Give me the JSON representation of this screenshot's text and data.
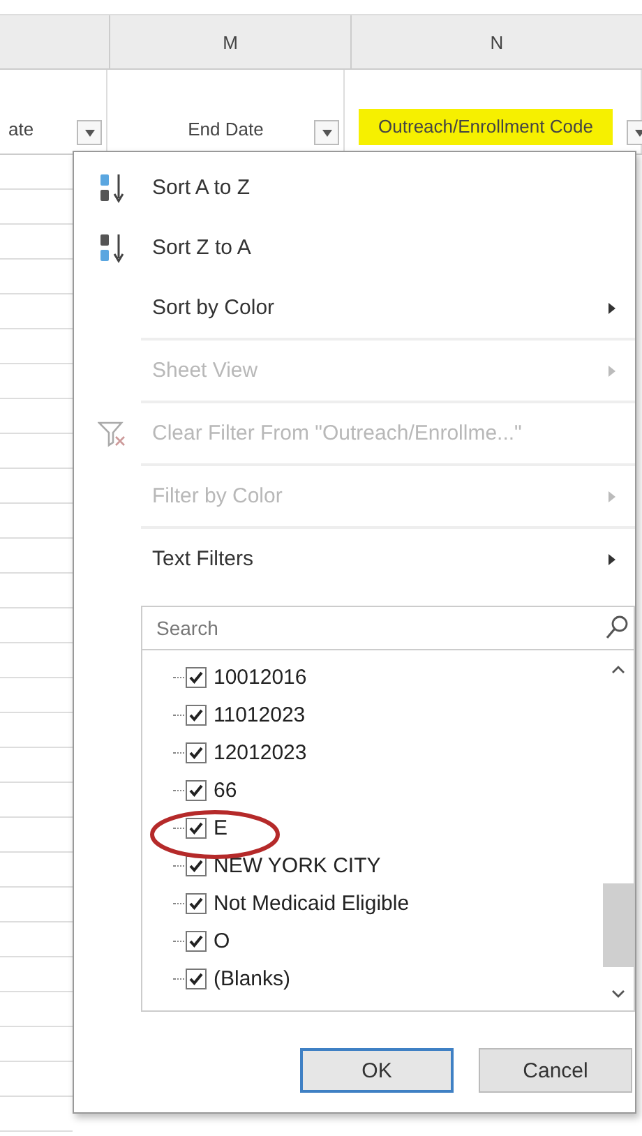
{
  "column_headers": [
    {
      "label": "M"
    },
    {
      "label": "N"
    }
  ],
  "header_cells": [
    {
      "text": "ate",
      "highlighted": false
    },
    {
      "text": "End Date",
      "highlighted": false
    },
    {
      "text": "Outreach/Enrollment Code",
      "highlighted": true
    }
  ],
  "menu": {
    "items": [
      {
        "label": "Sort A to Z",
        "kind": "sort-az",
        "disabled": false,
        "submenu": false
      },
      {
        "label": "Sort Z to A",
        "kind": "sort-za",
        "disabled": false,
        "submenu": false
      },
      {
        "label": "Sort by Color",
        "kind": "plain",
        "disabled": false,
        "submenu": true
      },
      {
        "label": "Sheet View",
        "kind": "plain",
        "disabled": true,
        "submenu": true
      },
      {
        "label": "Clear Filter From \"Outreach/Enrollme...\"",
        "kind": "clear-filter",
        "disabled": true,
        "submenu": false
      },
      {
        "label": "Filter by Color",
        "kind": "plain",
        "disabled": true,
        "submenu": true
      },
      {
        "label": "Text Filters",
        "kind": "plain",
        "disabled": false,
        "submenu": true
      }
    ],
    "search": {
      "placeholder": "Search"
    },
    "values": [
      {
        "label": "10012016",
        "checked": true
      },
      {
        "label": "11012023",
        "checked": true
      },
      {
        "label": "12012023",
        "checked": true
      },
      {
        "label": "66",
        "checked": true
      },
      {
        "label": "E",
        "checked": true
      },
      {
        "label": "NEW YORK CITY",
        "checked": true
      },
      {
        "label": "Not Medicaid Eligible",
        "checked": true
      },
      {
        "label": "O",
        "checked": true
      },
      {
        "label": "(Blanks)",
        "checked": true
      }
    ],
    "buttons": [
      {
        "label": "OK",
        "default": true
      },
      {
        "label": "Cancel",
        "default": false
      }
    ]
  }
}
